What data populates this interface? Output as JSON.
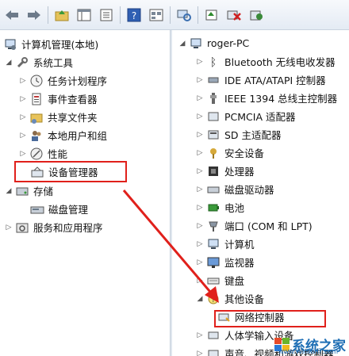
{
  "toolbar": {
    "buttons": [
      "back-arrow-icon",
      "forward-arrow-icon",
      "up-folder-icon",
      "console-tree-icon",
      "properties-icon",
      "help-icon",
      "view-icon",
      "scan-hardware-icon",
      "update-driver-icon",
      "disable-device-icon",
      "uninstall-icon"
    ]
  },
  "left_tree": {
    "root": "计算机管理(本地)",
    "system_tools": "系统工具",
    "task_scheduler": "任务计划程序",
    "event_viewer": "事件查看器",
    "shared_folders": "共享文件夹",
    "local_users": "本地用户和组",
    "performance": "性能",
    "device_manager": "设备管理器",
    "storage": "存储",
    "disk_management": "磁盘管理",
    "services": "服务和应用程序"
  },
  "right_tree": {
    "root": "roger-PC",
    "items": [
      "Bluetooth 无线电收发器",
      "IDE ATA/ATAPI 控制器",
      "IEEE 1394 总线主控制器",
      "PCMCIA 适配器",
      "SD 主适配器",
      "安全设备",
      "处理器",
      "磁盘驱动器",
      "电池",
      "端口 (COM 和 LPT)",
      "计算机",
      "监视器",
      "键盘",
      "其他设备",
      "网络控制器",
      "人体学输入设备",
      "声音、视频和游戏控制器"
    ]
  },
  "watermark": {
    "brand": "系统之家",
    "url": "www.Winwin7.com"
  },
  "colors": {
    "highlight_box": "#e0201b",
    "arrow": "#e0201b"
  }
}
